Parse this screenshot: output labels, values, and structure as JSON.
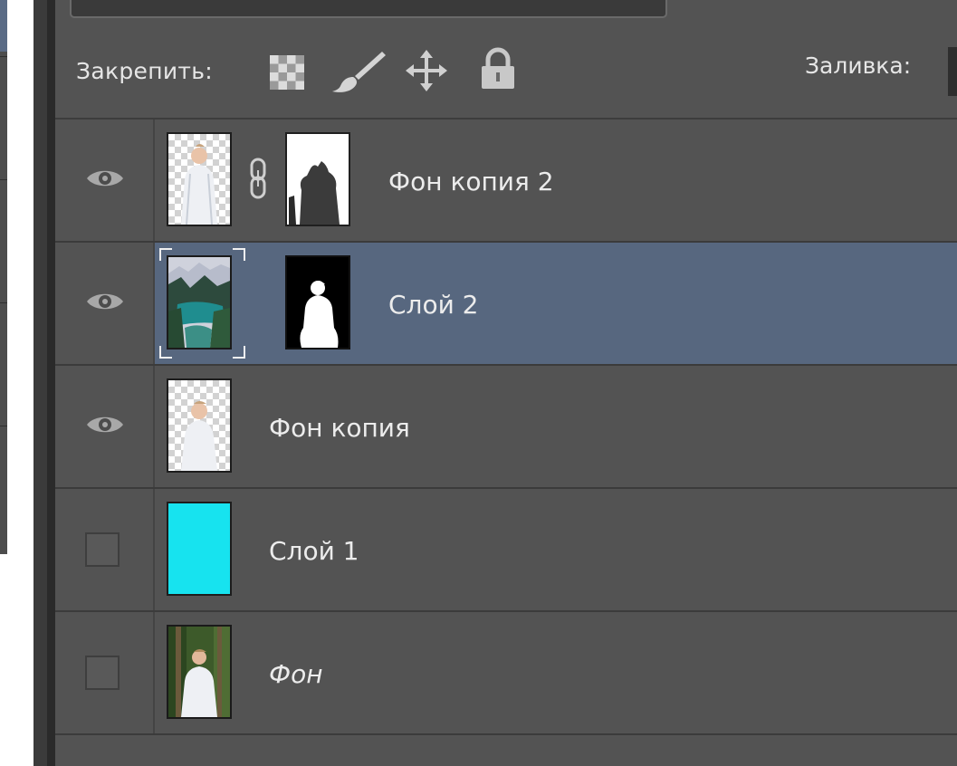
{
  "lock_bar": {
    "label": "Закрепить:",
    "icons": [
      "lock-transparent-pixels-icon",
      "lock-image-pixels-icon",
      "lock-position-icon",
      "lock-all-icon"
    ],
    "fill_label": "Заливка:"
  },
  "layers": [
    {
      "name": "Фон копия 2",
      "visible": true,
      "selected": false,
      "has_mask": true,
      "linked": true,
      "thumb": "person-transparent",
      "italic": false
    },
    {
      "name": "Слой 2",
      "visible": true,
      "selected": true,
      "has_mask": true,
      "linked": false,
      "thumb": "lake-landscape",
      "italic": false
    },
    {
      "name": "Фон копия",
      "visible": true,
      "selected": false,
      "has_mask": false,
      "linked": false,
      "thumb": "person-transparent",
      "italic": false
    },
    {
      "name": "Слой 1",
      "visible": false,
      "selected": false,
      "has_mask": false,
      "linked": false,
      "thumb": "cyan-fill",
      "italic": false
    },
    {
      "name": "Фон",
      "visible": false,
      "selected": false,
      "has_mask": false,
      "linked": false,
      "thumb": "person-forest-photo",
      "italic": true
    }
  ],
  "colors": {
    "panel_bg": "#535353",
    "selected_row": "#57677f",
    "cyan_fill": "#17e3ef",
    "text": "#ececec"
  }
}
